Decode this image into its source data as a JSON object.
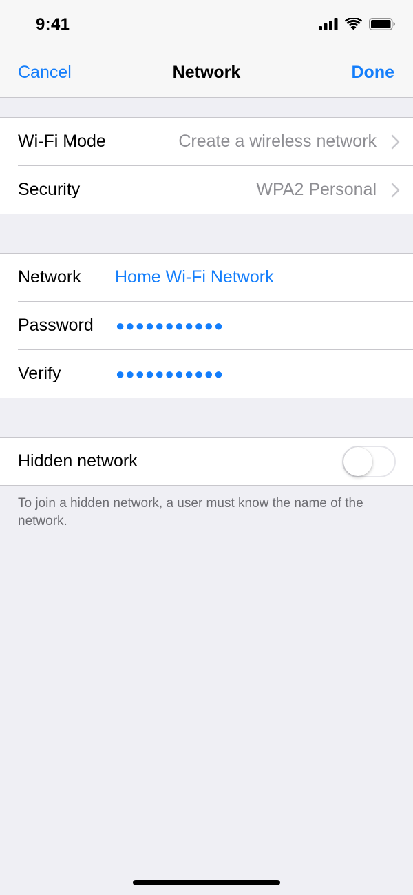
{
  "status_bar": {
    "time": "9:41",
    "icons": [
      "cellular-signal-icon",
      "wifi-icon",
      "battery-icon"
    ]
  },
  "nav": {
    "cancel_label": "Cancel",
    "title": "Network",
    "done_label": "Done"
  },
  "group1": {
    "wifi_mode": {
      "label": "Wi-Fi Mode",
      "value": "Create a wireless network"
    },
    "security": {
      "label": "Security",
      "value": "WPA2 Personal"
    }
  },
  "group2": {
    "network": {
      "label": "Network",
      "value": "Home Wi-Fi Network"
    },
    "password": {
      "label": "Password",
      "value": "●●●●●●●●●●●"
    },
    "verify": {
      "label": "Verify",
      "value": "●●●●●●●●●●●"
    }
  },
  "group3": {
    "hidden_network": {
      "label": "Hidden network",
      "enabled": false
    }
  },
  "footer_note": "To join a hidden network, a user must know the name of the network.",
  "colors": {
    "accent": "#147efb",
    "background": "#efeff4",
    "secondary_text": "#8e8e93",
    "separator": "#c8c7cc"
  }
}
